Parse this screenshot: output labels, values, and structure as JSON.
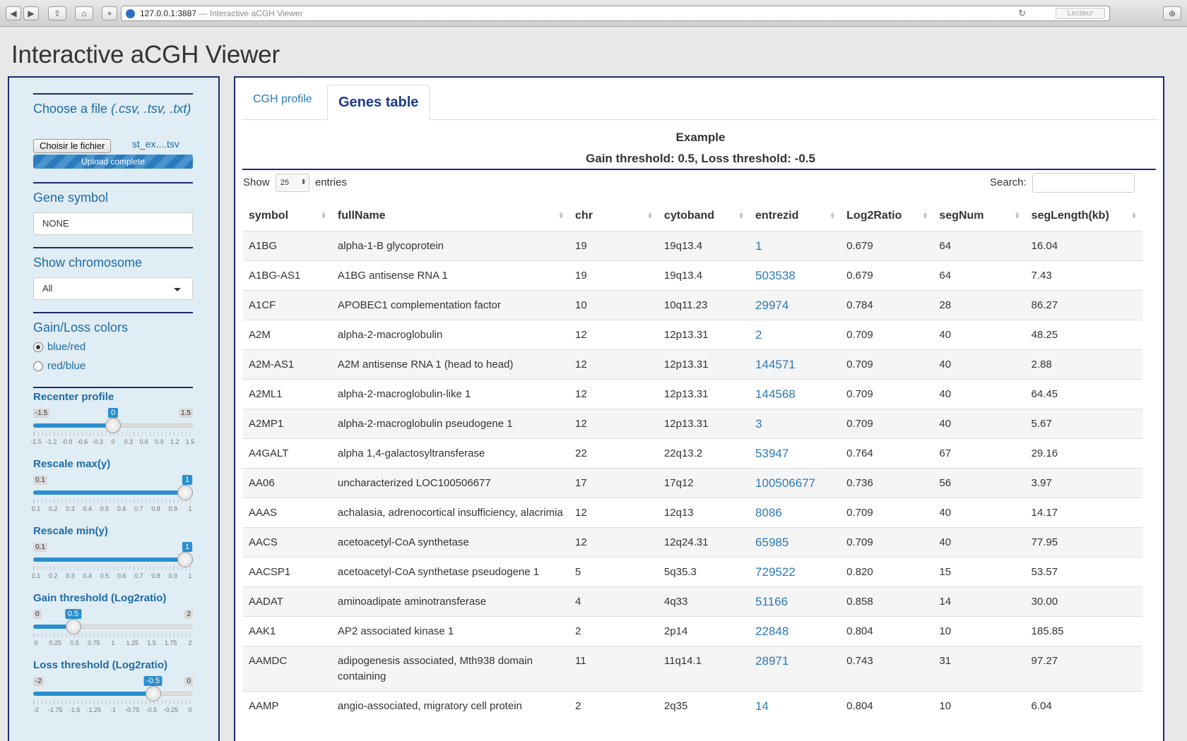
{
  "browser": {
    "url": "127.0.0.1:3887",
    "page_title": "— Interactive aCGH Viewer",
    "reader_label": "Lecteur",
    "back_glyph": "◀",
    "forward_glyph": "▶",
    "share_glyph": "⇪",
    "home_glyph": "⌂",
    "add_glyph": "+",
    "reload_glyph": "↻",
    "download_glyph": "⊕"
  },
  "app": {
    "title": "Interactive aCGH Viewer"
  },
  "sidebar": {
    "file": {
      "label": "Choose a file",
      "formats": "(.csv, .tsv, .txt)",
      "button": "Choisir le fichier",
      "filename": "st_ex....tsv",
      "status": "Upload complete"
    },
    "gene_symbol": {
      "label": "Gene symbol",
      "value": "NONE"
    },
    "chromosome": {
      "label": "Show chromosome",
      "value": "All"
    },
    "colors": {
      "label": "Gain/Loss colors",
      "options": [
        {
          "label": "blue/red",
          "checked": true
        },
        {
          "label": "red/blue",
          "checked": false
        }
      ]
    },
    "sliders": {
      "recenter": {
        "label": "Recenter profile",
        "min": "-1.5",
        "max": "1.5",
        "value": "0",
        "fraction": 0.5,
        "ticks": [
          "-1.5",
          "-1.2",
          "-0.9",
          "-0.6",
          "-0.3",
          "0",
          "0.3",
          "0.6",
          "0.9",
          "1.2",
          "1.5"
        ]
      },
      "rescale_max": {
        "label": "Rescale max(y)",
        "min": "0.1",
        "max": "1",
        "value": "1",
        "fraction": 1.0,
        "ticks": [
          "0.1",
          "0.2",
          "0.3",
          "0.4",
          "0.5",
          "0.6",
          "0.7",
          "0.8",
          "0.9",
          "1"
        ]
      },
      "rescale_min": {
        "label": "Rescale min(y)",
        "min": "0.1",
        "max": "1",
        "value": "1",
        "fraction": 1.0,
        "ticks": [
          "0.1",
          "0.2",
          "0.3",
          "0.4",
          "0.5",
          "0.6",
          "0.7",
          "0.8",
          "0.9",
          "1"
        ]
      },
      "gain": {
        "label": "Gain threshold (Log2ratio)",
        "min": "0",
        "max": "2",
        "value": "0.5",
        "fraction": 0.25,
        "ticks": [
          "0",
          "0.25",
          "0.5",
          "0.75",
          "1",
          "1.25",
          "1.5",
          "1.75",
          "2"
        ]
      },
      "loss": {
        "label": "Loss threshold (Log2ratio)",
        "min": "-2",
        "max": "0",
        "value": "-0.5",
        "fraction": 0.75,
        "ticks": [
          "-2",
          "-1.75",
          "-1.5",
          "-1.25",
          "-1",
          "-0.75",
          "-0.5",
          "-0.25",
          "0"
        ]
      }
    }
  },
  "main": {
    "tabs": [
      {
        "label": "CGH profile",
        "active": false
      },
      {
        "label": "Genes table",
        "active": true
      }
    ],
    "heading": "Example",
    "subheading": "Gain threshold: 0.5, Loss threshold: -0.5",
    "show_label": "Show",
    "entries_value": "25",
    "entries_label": "entries",
    "search_label": "Search:",
    "search_value": "",
    "columns": [
      "symbol",
      "fullName",
      "chr",
      "cytoband",
      "entrezid",
      "Log2Ratio",
      "segNum",
      "segLength(kb)"
    ],
    "rows": [
      [
        "A1BG",
        "alpha-1-B glycoprotein",
        "19",
        "19q13.4",
        "1",
        "0.679",
        "64",
        "16.04"
      ],
      [
        "A1BG-AS1",
        "A1BG antisense RNA 1",
        "19",
        "19q13.4",
        "503538",
        "0.679",
        "64",
        "7.43"
      ],
      [
        "A1CF",
        "APOBEC1 complementation factor",
        "10",
        "10q11.23",
        "29974",
        "0.784",
        "28",
        "86.27"
      ],
      [
        "A2M",
        "alpha-2-macroglobulin",
        "12",
        "12p13.31",
        "2",
        "0.709",
        "40",
        "48.25"
      ],
      [
        "A2M-AS1",
        "A2M antisense RNA 1 (head to head)",
        "12",
        "12p13.31",
        "144571",
        "0.709",
        "40",
        "2.88"
      ],
      [
        "A2ML1",
        "alpha-2-macroglobulin-like 1",
        "12",
        "12p13.31",
        "144568",
        "0.709",
        "40",
        "64.45"
      ],
      [
        "A2MP1",
        "alpha-2-macroglobulin pseudogene 1",
        "12",
        "12p13.31",
        "3",
        "0.709",
        "40",
        "5.67"
      ],
      [
        "A4GALT",
        "alpha 1,4-galactosyltransferase",
        "22",
        "22q13.2",
        "53947",
        "0.764",
        "67",
        "29.16"
      ],
      [
        "AA06",
        "uncharacterized LOC100506677",
        "17",
        "17q12",
        "100506677",
        "0.736",
        "56",
        "3.97"
      ],
      [
        "AAAS",
        "achalasia, adrenocortical insufficiency, alacrimia",
        "12",
        "12q13",
        "8086",
        "0.709",
        "40",
        "14.17"
      ],
      [
        "AACS",
        "acetoacetyl-CoA synthetase",
        "12",
        "12q24.31",
        "65985",
        "0.709",
        "40",
        "77.95"
      ],
      [
        "AACSP1",
        "acetoacetyl-CoA synthetase pseudogene 1",
        "5",
        "5q35.3",
        "729522",
        "0.820",
        "15",
        "53.57"
      ],
      [
        "AADAT",
        "aminoadipate aminotransferase",
        "4",
        "4q33",
        "51166",
        "0.858",
        "14",
        "30.00"
      ],
      [
        "AAK1",
        "AP2 associated kinase 1",
        "2",
        "2p14",
        "22848",
        "0.804",
        "10",
        "185.85"
      ],
      [
        "AAMDC",
        "adipogenesis associated, Mth938 domain containing",
        "11",
        "11q14.1",
        "28971",
        "0.743",
        "31",
        "97.27"
      ],
      [
        "AAMP",
        "angio-associated, migratory cell protein",
        "2",
        "2q35",
        "14",
        "0.804",
        "10",
        "6.04"
      ]
    ]
  }
}
